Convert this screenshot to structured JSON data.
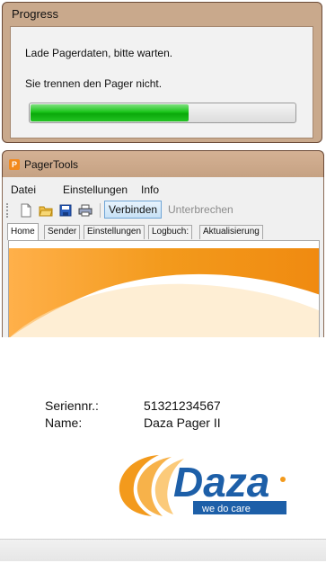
{
  "progress_dialog": {
    "title": "Progress",
    "message1": "Lade Pagerdaten, bitte warten.",
    "message2": "Sie trennen den Pager nicht.",
    "progress": 0.6,
    "bar_color": "#19c419"
  },
  "pagertools": {
    "title": "PagerTools",
    "app_icon": "pagertools-app-icon",
    "menu": [
      "Datei",
      "Einstellungen",
      "Info"
    ],
    "toolbar": {
      "icons": [
        "new-file-icon",
        "open-folder-icon",
        "save-disk-icon",
        "print-icon"
      ],
      "connect_label": "Verbinden",
      "disconnect_label": "Unterbrechen"
    },
    "tabs": [
      "Home",
      "Sender",
      "Einstellungen",
      "Logbuch:",
      "Aktualisierung"
    ],
    "active_tab": "Home",
    "accent_color": "#f39a1c"
  },
  "device": {
    "serial_label": "Seriennr.:",
    "serial_value": "51321234567",
    "name_label": "Name:",
    "name_value": "Daza Pager II"
  },
  "logo": {
    "brand": "Daza",
    "tagline": "we do care",
    "brand_color": "#1d5fa8",
    "swoosh_color": "#f39a1c"
  }
}
